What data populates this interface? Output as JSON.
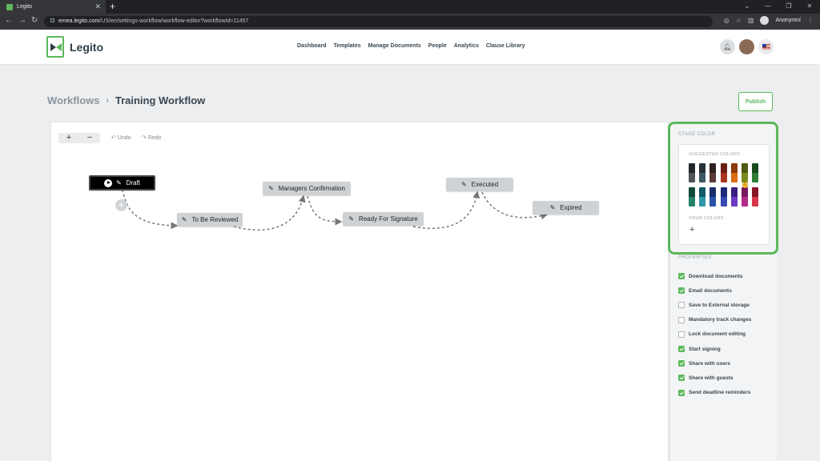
{
  "browser": {
    "tab_title": "Legito",
    "new_tab": "+",
    "url_host": "emea.legito.com",
    "url_path": "/US/en/settings-workflow/workflow-editor?workflowId=11457",
    "profile_label": "Anonymní"
  },
  "app": {
    "logo_text": "Legito",
    "nav": [
      "Dashboard",
      "Templates",
      "Manage Documents",
      "People",
      "Analytics",
      "Clause Library"
    ]
  },
  "breadcrumb": {
    "parent": "Workflows",
    "separator": "›",
    "current": "Training Workflow"
  },
  "actions": {
    "publish": "Publish"
  },
  "toolbar": {
    "zoom_in": "+",
    "zoom_out": "−",
    "undo": "Undo",
    "redo": "Redo"
  },
  "workflow": {
    "add_stage": "+",
    "stages": [
      "Draft",
      "To Be Reviewed",
      "Managers Confirmation",
      "Ready For Signature",
      "Executed",
      "Expired"
    ]
  },
  "panel": {
    "stage_color_title": "STAGE COLOR",
    "suggested_title": "SUGGESTED COLORS",
    "your_colors_title": "YOUR COLORS",
    "add_color": "+",
    "suggested_colors": [
      [
        "#23282c",
        "#4d5459"
      ],
      [
        "#27313a",
        "#3f5866"
      ],
      [
        "#2f2222",
        "#5a3a36"
      ],
      [
        "#6b1f14",
        "#a8351f"
      ],
      [
        "#8b3a08",
        "#d96d13"
      ],
      [
        "#4f5a12",
        "#7c8a1c"
      ],
      [
        "#174a1b",
        "#2f7d34"
      ],
      [
        "#0f4a38",
        "#27806a"
      ],
      [
        "#0f5a66",
        "#2f98a8"
      ],
      [
        "#17306b",
        "#2a52a6"
      ],
      [
        "#1c2a7a",
        "#3649b0"
      ],
      [
        "#3a1f80",
        "#6d3bc4"
      ],
      [
        "#7b1660",
        "#b52b8a"
      ],
      [
        "#8a1426",
        "#d6374a"
      ]
    ],
    "properties_title": "PROPERTIES",
    "properties": [
      {
        "label": "Download documents",
        "checked": true
      },
      {
        "label": "Email documents",
        "checked": true
      },
      {
        "label": "Save to External storage",
        "checked": false
      },
      {
        "label": "Mandatory track changes",
        "checked": false
      },
      {
        "label": "Lock document editing",
        "checked": false
      },
      {
        "label": "Start signing",
        "checked": true
      },
      {
        "label": "Share with users",
        "checked": true
      },
      {
        "label": "Share with guests",
        "checked": true
      },
      {
        "label": "Send deadline reminders",
        "checked": true
      }
    ]
  },
  "colors": {
    "accent": "#5cb85c",
    "stage_default": "#cfd2d4",
    "stage_active": "#000000"
  }
}
